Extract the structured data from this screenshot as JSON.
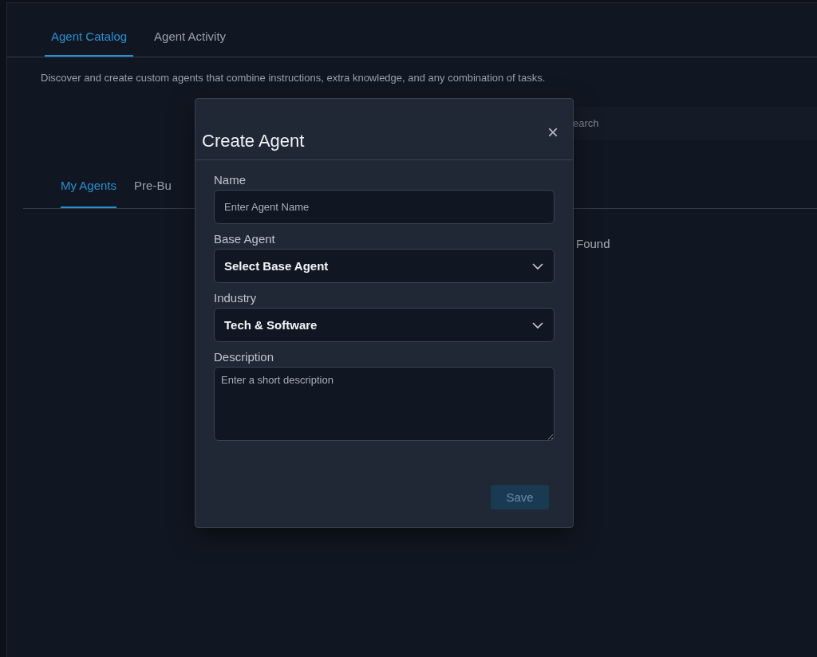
{
  "tabs": [
    {
      "label": "Agent Catalog",
      "selected": true
    },
    {
      "label": "Agent Activity",
      "selected": false
    }
  ],
  "description": "Discover and create custom agents that combine instructions, extra knowledge, and any combination of tasks.",
  "search": {
    "placeholder": "earch"
  },
  "agent_tabs": [
    {
      "label": "My Agents",
      "selected": true
    },
    {
      "label": "Pre-Bu",
      "selected": false
    }
  ],
  "empty_message": "Found",
  "dialog": {
    "title": "Create Agent",
    "close": "×",
    "fields": [
      {
        "kind": "text",
        "label": "Name",
        "placeholder": "Enter Agent Name"
      },
      {
        "kind": "select",
        "label": "Base Agent",
        "value": "Select Base Agent"
      },
      {
        "kind": "select",
        "label": "Industry",
        "value": "Tech & Software"
      },
      {
        "kind": "textarea",
        "label": "Description",
        "placeholder": "Enter a short description"
      }
    ],
    "save": {
      "label": "Save",
      "disabled": true
    }
  }
}
